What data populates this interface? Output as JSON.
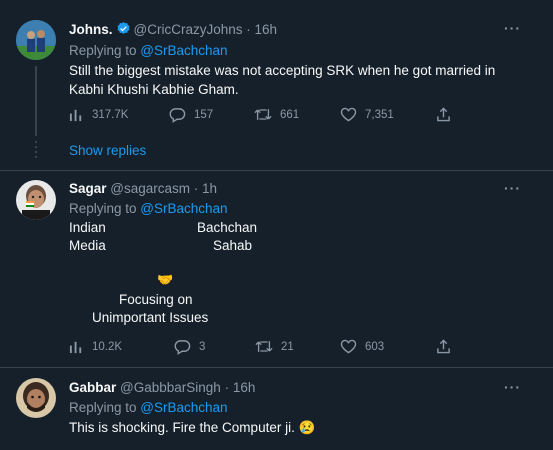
{
  "tweets": [
    {
      "name": "Johns.",
      "handle": "@CricCrazyJohns",
      "time": "· 16h",
      "replying_label": "Replying to ",
      "replying_to": "@SrBachchan",
      "lines": [
        "Still the biggest mistake was not accepting SRK when he got married in",
        "Kabhi Khushi Kabhie Gham."
      ],
      "stats": {
        "views": "317.7K",
        "replies": "157",
        "retweets": "661",
        "likes": "7,351"
      },
      "verified": true
    },
    {
      "name": "Sagar",
      "handle": "@sagarcasm",
      "time": "· 1h",
      "replying_label": "Replying to ",
      "replying_to": "@SrBachchan",
      "meme": {
        "left_top": "Indian",
        "left_bottom": "Media",
        "right_top": "Bachchan",
        "right_bottom": "Sahab",
        "emoji": "🤝",
        "caption1": "Focusing on",
        "caption2": "Unimportant Issues"
      },
      "stats": {
        "views": "10.2K",
        "replies": "3",
        "retweets": "21",
        "likes": "603"
      }
    },
    {
      "name": "Gabbar",
      "handle": "@GabbbarSingh",
      "time": "· 16h",
      "replying_label": "Replying to ",
      "replying_to": "@SrBachchan",
      "lines": [
        "This is shocking. Fire the Computer ji. 😢"
      ]
    }
  ],
  "show_replies": "Show replies",
  "more_label": "···",
  "icons": {
    "views": "bar-chart-icon",
    "reply": "speech-bubble-icon",
    "retweet": "retweet-icon",
    "like": "heart-icon",
    "share": "share-icon",
    "verified": "verified-badge-icon"
  },
  "colors": {
    "background": "#15202b",
    "accent": "#1d9bf0",
    "muted": "#8b98a5",
    "separator": "#38444d"
  }
}
